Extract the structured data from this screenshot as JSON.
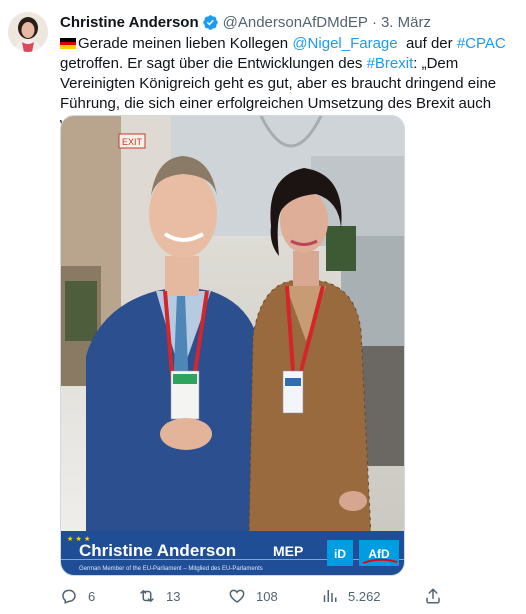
{
  "author": {
    "name": "Christine Anderson",
    "handle": "@AndersonAfDMdEP",
    "separator": "·",
    "date": "3. März"
  },
  "text": {
    "part1": "Gerade meinen lieben Kollegen ",
    "mention": "@Nigel_Farage",
    "part2": "  auf der ",
    "hashtag1": "#CPAC",
    "part3": " getroffen. Er sagt über die Entwicklungen des ",
    "hashtag2": "#Brexit",
    "part4": ": „Dem Vereinigten Königreich geht es gut, aber es braucht dringend eine Führung, die sich einer erfolgreichen Umsetzung des Brexit auch wirklich verpflichtet fühlt.“"
  },
  "media": {
    "exit_sign": "EXIT",
    "banner_name": "Christine Anderson",
    "banner_title": "MEP",
    "banner_subtitle": "German Member of the EU-Parliament – Mitglied des EU-Parlaments",
    "badge_label": "AfD",
    "badge_id_label": "iD"
  },
  "actions": {
    "replies": "6",
    "retweets": "13",
    "likes": "108",
    "views": "5.262"
  },
  "colors": {
    "link": "#1d9bf0",
    "verified": "#1d9bf0",
    "secondary_text": "#536471",
    "banner_blue": "#1f4e97",
    "afd_blue": "#009ee0"
  }
}
